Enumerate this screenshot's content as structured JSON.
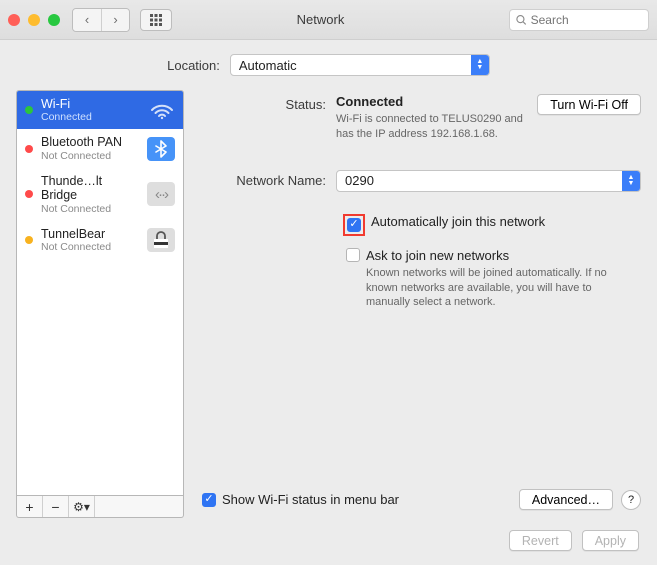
{
  "window": {
    "title": "Network",
    "search_placeholder": "Search"
  },
  "location": {
    "label": "Location:",
    "value": "Automatic"
  },
  "sidebar": {
    "items": [
      {
        "name": "Wi-Fi",
        "status": "Connected",
        "dot": "dg",
        "selected": true,
        "icon": "wifi"
      },
      {
        "name": "Bluetooth PAN",
        "status": "Not Connected",
        "dot": "dr",
        "selected": false,
        "icon": "bt"
      },
      {
        "name": "Thunde…lt Bridge",
        "status": "Not Connected",
        "dot": "dr",
        "selected": false,
        "icon": "tb"
      },
      {
        "name": "TunnelBear",
        "status": "Not Connected",
        "dot": "dy",
        "selected": false,
        "icon": "lock"
      }
    ],
    "buttons": {
      "add": "+",
      "remove": "−",
      "gear": "⚙︎▾"
    }
  },
  "detail": {
    "status_label": "Status:",
    "status_value": "Connected",
    "turn_off": "Turn Wi-Fi Off",
    "status_desc": "Wi-Fi is connected to TELUS0290 and has the IP address 192.168.1.68.",
    "netname_label": "Network Name:",
    "netname_value": "0290",
    "auto_join": "Automatically join this network",
    "ask_join": "Ask to join new networks",
    "ask_desc": "Known networks will be joined automatically. If no known networks are available, you will have to manually select a network.",
    "show_menu": "Show Wi-Fi status in menu bar",
    "advanced": "Advanced…",
    "help": "?"
  },
  "bottom": {
    "revert": "Revert",
    "apply": "Apply"
  }
}
